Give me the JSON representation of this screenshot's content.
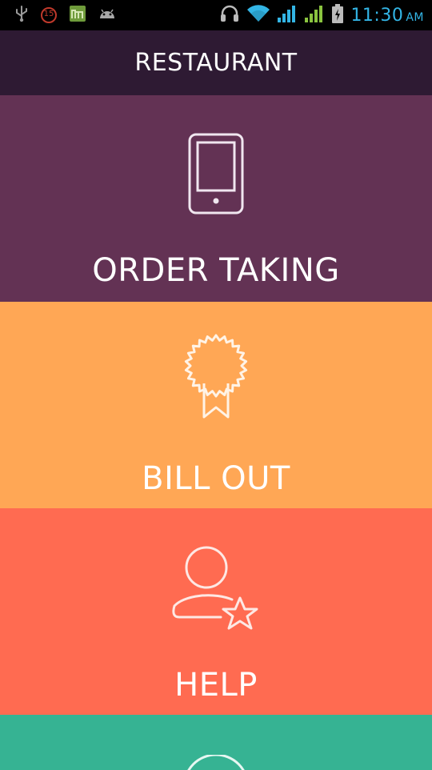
{
  "status_bar": {
    "time": "11:30",
    "ampm": "AM",
    "notification_badge": "15",
    "accent_color": "#33b5e5"
  },
  "app_bar": {
    "title": "RESTAURANT",
    "background": "#2e1a33"
  },
  "menu": {
    "items": [
      {
        "label": "ORDER TAKING",
        "icon": "tablet-icon",
        "color": "#633254"
      },
      {
        "label": "BILL OUT",
        "icon": "award-ribbon-icon",
        "color": "#ffa755"
      },
      {
        "label": "HELP",
        "icon": "user-star-icon",
        "color": "#ff6b51"
      },
      {
        "label": "",
        "icon": "circle-icon",
        "color": "#36b393"
      }
    ]
  }
}
